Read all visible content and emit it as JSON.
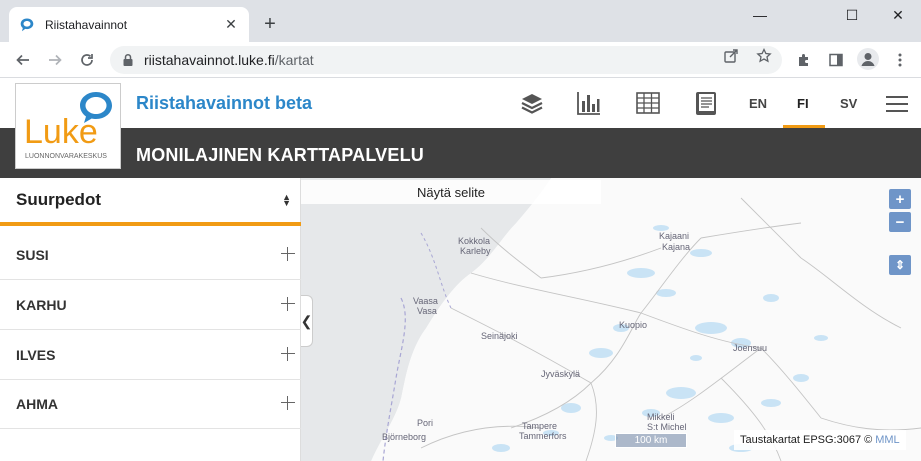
{
  "browser": {
    "tab_title": "Riistahavainnot",
    "url_host": "riistahavainnot.luke.fi",
    "url_path": "/kartat",
    "new_tab_symbol": "+",
    "close_symbol": "✕",
    "minimize_symbol": "—",
    "maximize_symbol": "☐",
    "close_window_symbol": "✕"
  },
  "logo": {
    "brand": "Luke",
    "subtitle": "LUONNONVARAKESKUS",
    "brand_color": "#f19b14",
    "bubble_color": "#2c87c9"
  },
  "header": {
    "app_title": "Riistahavainnot beta",
    "languages": [
      "EN",
      "FI",
      "SV"
    ],
    "active_language": "FI",
    "icons": [
      "layers-icon",
      "bar-chart-icon",
      "table-icon",
      "book-icon",
      "menu-icon"
    ]
  },
  "banner": {
    "title": "MONILAJINEN KARTTAPALVELU"
  },
  "sidebar": {
    "select_value": "Suurpedot",
    "items": [
      {
        "label": "SUSI"
      },
      {
        "label": "KARHU"
      },
      {
        "label": "ILVES"
      },
      {
        "label": "AHMA"
      }
    ],
    "collapse_symbol": "❮"
  },
  "map": {
    "legend_toggle": "Näytä selite",
    "zoom_in": "+",
    "zoom_out": "−",
    "layer_toggle": "⇕",
    "scale_label": "100 km",
    "attribution_text": "Taustakartat EPSG:3067 ©",
    "attribution_link": "MML",
    "place_labels": [
      {
        "text": "Kokkola"
      },
      {
        "text": "Karleby"
      },
      {
        "text": "Vaasa"
      },
      {
        "text": "Vasa"
      },
      {
        "text": "Seinäjoki"
      },
      {
        "text": "Kajaani"
      },
      {
        "text": "Kajana"
      },
      {
        "text": "Kuopio"
      },
      {
        "text": "Joensuu"
      },
      {
        "text": "Jyväskylä"
      },
      {
        "text": "Pori"
      },
      {
        "text": "Björneborg"
      },
      {
        "text": "Tampere"
      },
      {
        "text": "Tammerfors"
      },
      {
        "text": "Mikkeli"
      },
      {
        "text": "S:t Michel"
      }
    ]
  }
}
